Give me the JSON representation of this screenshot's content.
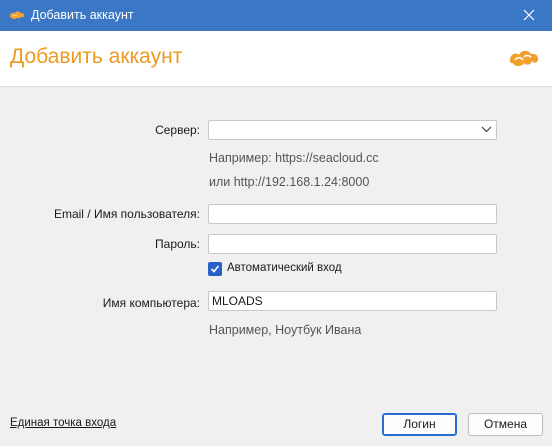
{
  "window": {
    "title": "Добавить аккаунт",
    "close_icon": "close-icon"
  },
  "header": {
    "title": "Добавить аккаунт",
    "logo_icon": "seafile-logo",
    "accent_color": "#ec9a22"
  },
  "form": {
    "server": {
      "label": "Сервер:",
      "value": "",
      "hint1": "Например: https://seacloud.cc",
      "hint2": "или http://192.168.1.24:8000"
    },
    "email": {
      "label": "Email / Имя пользователя:",
      "value": ""
    },
    "password": {
      "label": "Пароль:",
      "value": ""
    },
    "auto_login": {
      "label": "Автоматический вход",
      "checked": true
    },
    "computer_name": {
      "label": "Имя компьютера:",
      "value": "MLOADS",
      "hint": "Например, Ноутбук Ивана"
    }
  },
  "footer": {
    "sso_link": "Единая точка входа",
    "login_button": "Логин",
    "cancel_button": "Отмена"
  },
  "colors": {
    "titlebar": "#3a77c4",
    "checkbox": "#2862c6",
    "primary_border": "#2a6bd0"
  }
}
